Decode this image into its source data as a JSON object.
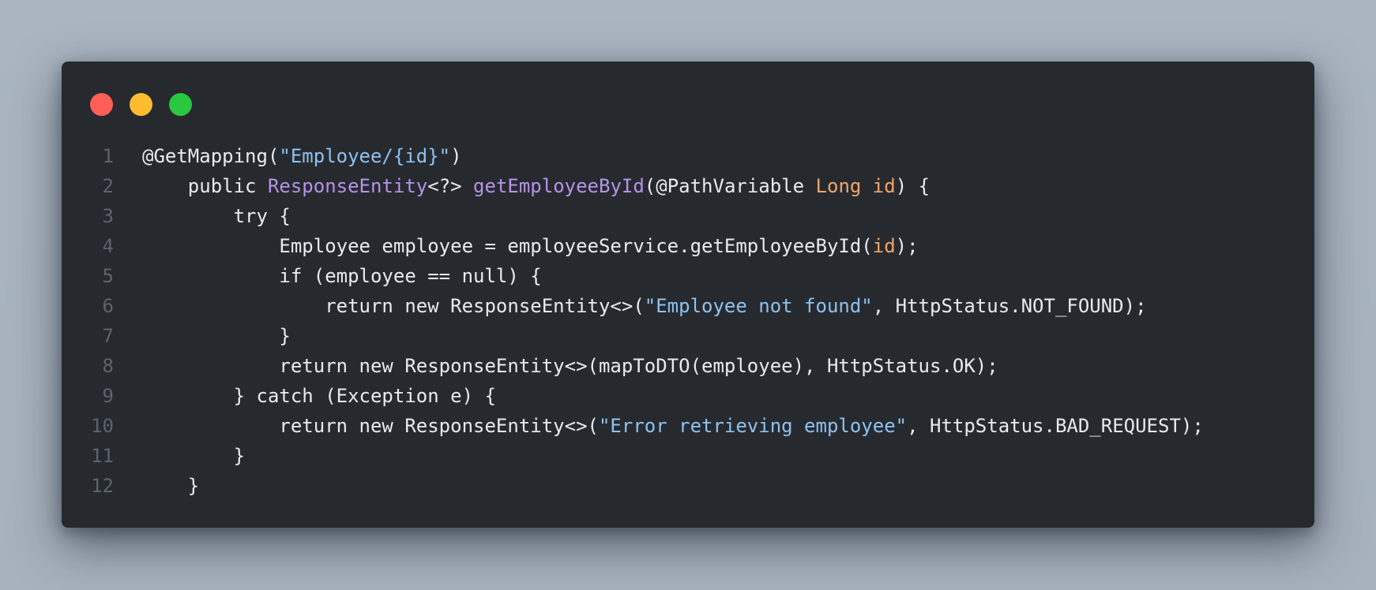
{
  "window": {
    "controls": [
      {
        "name": "close",
        "color": "#ff5f57"
      },
      {
        "name": "minimize",
        "color": "#febc2e"
      },
      {
        "name": "maximize",
        "color": "#28c840"
      }
    ]
  },
  "theme": {
    "plain": "#e8eaed",
    "string": "#8fc1f0",
    "type": "#b792e6",
    "param": "#f0a56c",
    "line_number": "#5c636c",
    "background": "#262a2f"
  },
  "code": {
    "language": "java",
    "lines": [
      {
        "number": "1",
        "tokens": [
          {
            "text": "@GetMapping(",
            "kind": "plain"
          },
          {
            "text": "\"Employee/{id}\"",
            "kind": "string"
          },
          {
            "text": ")",
            "kind": "plain"
          }
        ]
      },
      {
        "number": "2",
        "tokens": [
          {
            "text": "    public ",
            "kind": "plain"
          },
          {
            "text": "ResponseEntity",
            "kind": "type"
          },
          {
            "text": "<?> ",
            "kind": "plain"
          },
          {
            "text": "getEmployeeById",
            "kind": "func"
          },
          {
            "text": "(@PathVariable ",
            "kind": "plain"
          },
          {
            "text": "Long",
            "kind": "param"
          },
          {
            "text": " ",
            "kind": "plain"
          },
          {
            "text": "id",
            "kind": "param"
          },
          {
            "text": ") {",
            "kind": "plain"
          }
        ]
      },
      {
        "number": "3",
        "tokens": [
          {
            "text": "        try {",
            "kind": "plain"
          }
        ]
      },
      {
        "number": "4",
        "tokens": [
          {
            "text": "            Employee employee = employeeService.getEmployeeById(",
            "kind": "plain"
          },
          {
            "text": "id",
            "kind": "param"
          },
          {
            "text": ");",
            "kind": "plain"
          }
        ]
      },
      {
        "number": "5",
        "tokens": [
          {
            "text": "            if (employee == null) {",
            "kind": "plain"
          }
        ]
      },
      {
        "number": "6",
        "tokens": [
          {
            "text": "                return new ResponseEntity<>(",
            "kind": "plain"
          },
          {
            "text": "\"Employee not found\"",
            "kind": "string"
          },
          {
            "text": ", HttpStatus.NOT_FOUND);",
            "kind": "plain"
          }
        ]
      },
      {
        "number": "7",
        "tokens": [
          {
            "text": "            }",
            "kind": "plain"
          }
        ]
      },
      {
        "number": "8",
        "tokens": [
          {
            "text": "            return new ResponseEntity<>(mapToDTO(employee), HttpStatus.OK);",
            "kind": "plain"
          }
        ]
      },
      {
        "number": "9",
        "tokens": [
          {
            "text": "        } catch (Exception e) {",
            "kind": "plain"
          }
        ]
      },
      {
        "number": "10",
        "tokens": [
          {
            "text": "            return new ResponseEntity<>(",
            "kind": "plain"
          },
          {
            "text": "\"Error retrieving employee\"",
            "kind": "string"
          },
          {
            "text": ", HttpStatus.BAD_REQUEST);",
            "kind": "plain"
          }
        ]
      },
      {
        "number": "11",
        "tokens": [
          {
            "text": "        }",
            "kind": "plain"
          }
        ]
      },
      {
        "number": "12",
        "tokens": [
          {
            "text": "    }",
            "kind": "plain"
          }
        ]
      }
    ]
  }
}
